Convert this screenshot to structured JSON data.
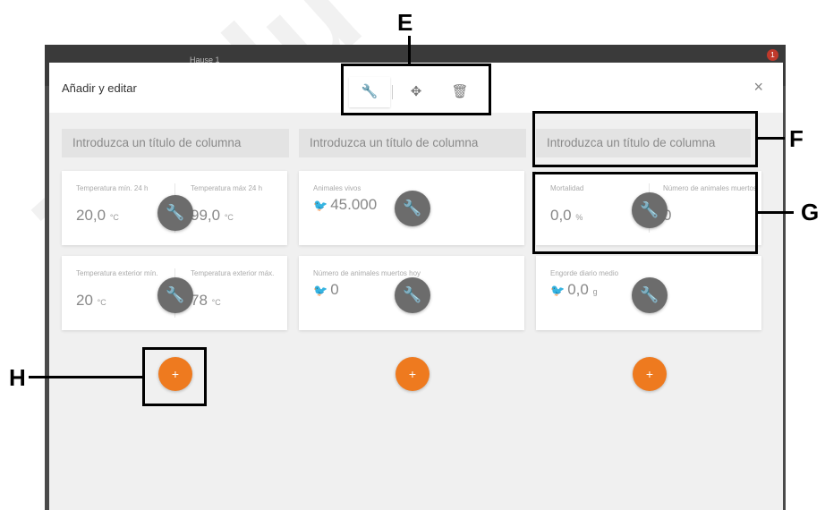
{
  "app": {
    "window_title": "Hause 1",
    "notification_count": "1"
  },
  "dialog": {
    "title": "Añadir y editar",
    "toolbar": {
      "edit_icon": "🔧",
      "move_icon": "✥",
      "delete_icon": "🗑"
    }
  },
  "columns": [
    {
      "title": "Introduzca un título de columna",
      "cards": [
        {
          "metrics": [
            {
              "label": "Temperatura mín. 24 h",
              "value": "20,0",
              "unit": "°C"
            },
            {
              "label": "Temperatura máx 24 h",
              "value": "99,0",
              "unit": "°C"
            }
          ]
        },
        {
          "metrics": [
            {
              "label": "Temperatura exterior mín.",
              "value": "20",
              "unit": "°C"
            },
            {
              "label": "Temperatura exterior máx.",
              "value": "78",
              "unit": "°C"
            }
          ]
        }
      ]
    },
    {
      "title": "Introduzca un título de columna",
      "cards": [
        {
          "metrics": [
            {
              "label": "Animales vivos",
              "value": "45.000",
              "unit": ""
            }
          ]
        },
        {
          "metrics": [
            {
              "label": "Número de animales muertos hoy",
              "value": "0",
              "unit": ""
            }
          ]
        }
      ]
    },
    {
      "title": "Introduzca un título de columna",
      "cards": [
        {
          "metrics": [
            {
              "label": "Mortalidad",
              "value": "0,0",
              "unit": "%"
            },
            {
              "label": "Número de animales muertos",
              "value": "0",
              "unit": ""
            }
          ]
        },
        {
          "metrics": [
            {
              "label": "Engorde diario medio",
              "value": "0,0",
              "unit": "g"
            }
          ]
        }
      ]
    }
  ],
  "icons": {
    "wrench": "🔧",
    "plus": "+",
    "bird": "🐦",
    "close": "×"
  },
  "callouts": {
    "E": "E",
    "F": "F",
    "G": "G",
    "H": "H"
  },
  "watermark": "Tradu",
  "colors": {
    "accent_orange": "#ee7a1f",
    "fab_gray": "#6c6c6c"
  }
}
